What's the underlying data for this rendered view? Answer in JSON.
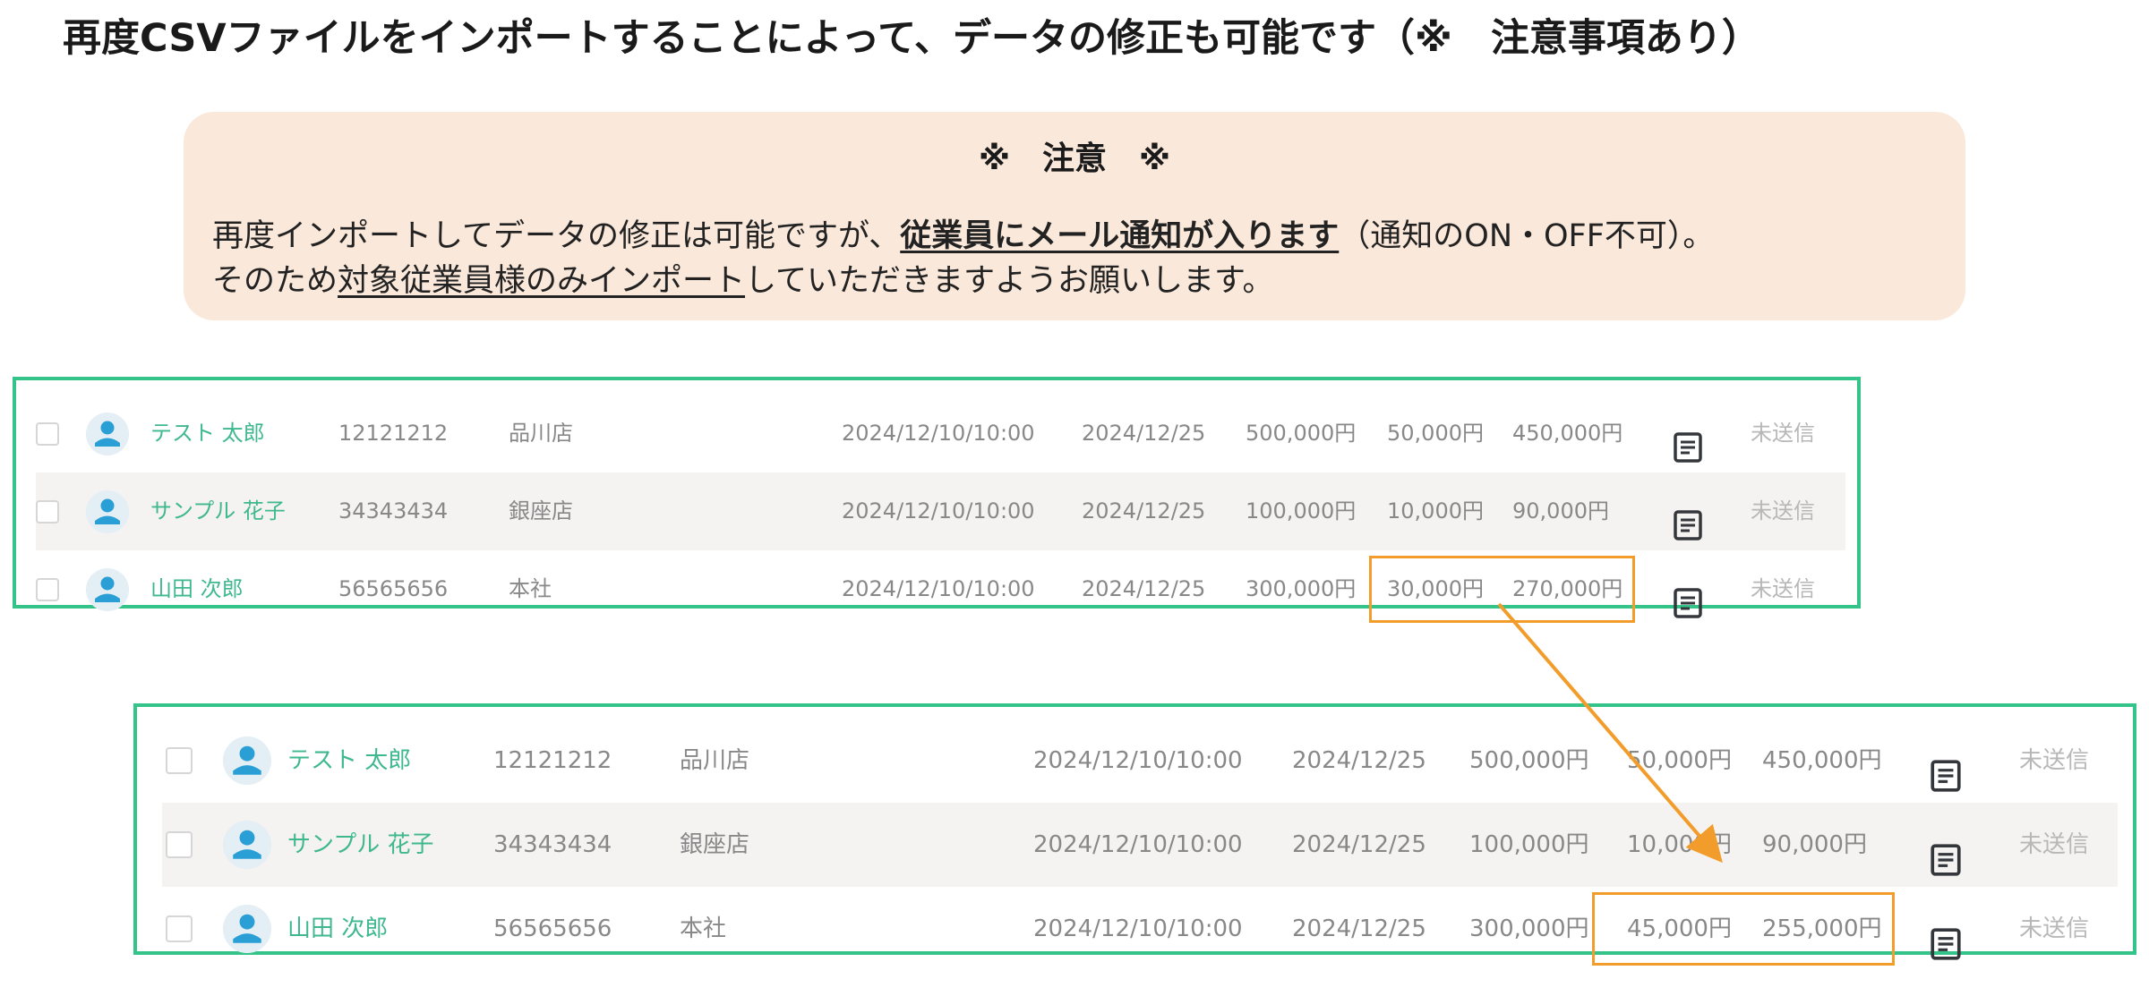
{
  "page": {
    "title": "再度CSVファイルをインポートすることによって、データの修正も可能です（※　注意事項あり）"
  },
  "notice": {
    "heading": "※　注意　※",
    "line1_before": "再度インポートしてデータの修正は可能ですが、",
    "line1_emphasis": "従業員にメール通知が入ります",
    "line1_after": "（通知のON・OFF不可）。",
    "line2_before": "そのため",
    "line2_emphasis": "対象従業員様のみインポート",
    "line2_after": "していただきますようお願いします。"
  },
  "tables": {
    "before": {
      "rows": [
        {
          "name": "テスト 太郎",
          "id": "12121212",
          "store": "品川店",
          "datetime": "2024/12/10/10:00",
          "date": "2024/12/25",
          "amount": "500,000円",
          "deduction": "50,000円",
          "net": "450,000円",
          "status": "未送信"
        },
        {
          "name": "サンプル 花子",
          "id": "34343434",
          "store": "銀座店",
          "datetime": "2024/12/10/10:00",
          "date": "2024/12/25",
          "amount": "100,000円",
          "deduction": "10,000円",
          "net": "90,000円",
          "status": "未送信"
        },
        {
          "name": "山田 次郎",
          "id": "56565656",
          "store": "本社",
          "datetime": "2024/12/10/10:00",
          "date": "2024/12/25",
          "amount": "300,000円",
          "deduction": "30,000円",
          "net": "270,000円",
          "status": "未送信"
        }
      ]
    },
    "after": {
      "rows": [
        {
          "name": "テスト 太郎",
          "id": "12121212",
          "store": "品川店",
          "datetime": "2024/12/10/10:00",
          "date": "2024/12/25",
          "amount": "500,000円",
          "deduction": "50,000円",
          "net": "450,000円",
          "status": "未送信"
        },
        {
          "name": "サンプル 花子",
          "id": "34343434",
          "store": "銀座店",
          "datetime": "2024/12/10/10:00",
          "date": "2024/12/25",
          "amount": "100,000円",
          "deduction": "10,000円",
          "net": "90,000円",
          "status": "未送信"
        },
        {
          "name": "山田 次郎",
          "id": "56565656",
          "store": "本社",
          "datetime": "2024/12/10/10:00",
          "date": "2024/12/25",
          "amount": "300,000円",
          "deduction": "45,000円",
          "net": "255,000円",
          "status": "未送信"
        }
      ]
    }
  },
  "colors": {
    "frame": "#34c489",
    "highlight": "#f29c2b",
    "notice_bg": "#fae8da",
    "name_text": "#3fb88f",
    "row_alt": "#f5f2f2"
  },
  "icons": {
    "avatar": "person-avatar-icon",
    "document": "document-icon",
    "checkbox": "checkbox-icon",
    "arrow": "arrow-icon"
  }
}
